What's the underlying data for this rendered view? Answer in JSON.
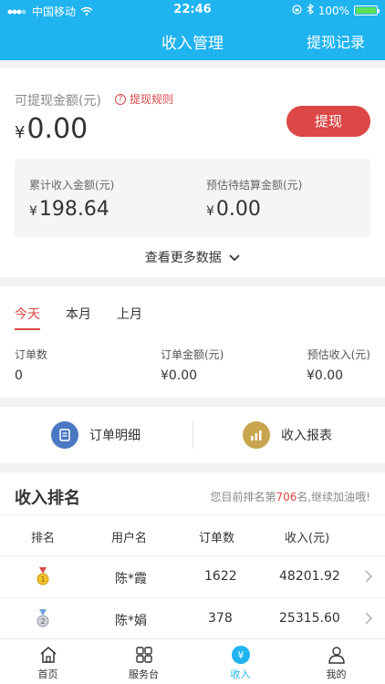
{
  "status": {
    "carrier": "中国移动",
    "time": "22:46",
    "battery": "100%"
  },
  "header": {
    "title": "收入管理",
    "right_link": "提现记录"
  },
  "summary": {
    "withdrawable_label": "可提现金额(元)",
    "rules_label": "提现规则",
    "currency": "¥",
    "withdrawable_amount": "0.00",
    "withdraw_button": "提现",
    "total_income_label": "累计收入金额(元)",
    "total_income": "198.64",
    "pending_label": "预估待结算金额(元)",
    "pending": "0.00",
    "more_data": "查看更多数据"
  },
  "period": {
    "tabs": [
      "今天",
      "本月",
      "上月"
    ],
    "active_tab": "今天",
    "orders_label": "订单数",
    "orders": "0",
    "order_amount_label": "订单金额(元)",
    "order_amount": "¥0.00",
    "est_income_label": "预估收入(元)",
    "est_income": "¥0.00"
  },
  "links": {
    "order_detail": "订单明细",
    "income_report": "收入报表"
  },
  "ranking": {
    "title": "收入排名",
    "note_prefix": "您目前排名第",
    "my_rank": "706",
    "note_suffix": "名,继续加油哦!",
    "columns": [
      "排名",
      "用户名",
      "订单数",
      "收入(元)"
    ],
    "rows": [
      {
        "rank": "1",
        "user": "陈*霞",
        "orders": "1622",
        "income": "48201.92"
      },
      {
        "rank": "2",
        "user": "陈*娟",
        "orders": "378",
        "income": "25315.60"
      }
    ]
  },
  "tabbar": {
    "home": "首页",
    "service": "服务台",
    "income": "收入",
    "mine": "我的"
  },
  "colors": {
    "brand": "#1fb3f0",
    "accent": "#dd4747"
  }
}
